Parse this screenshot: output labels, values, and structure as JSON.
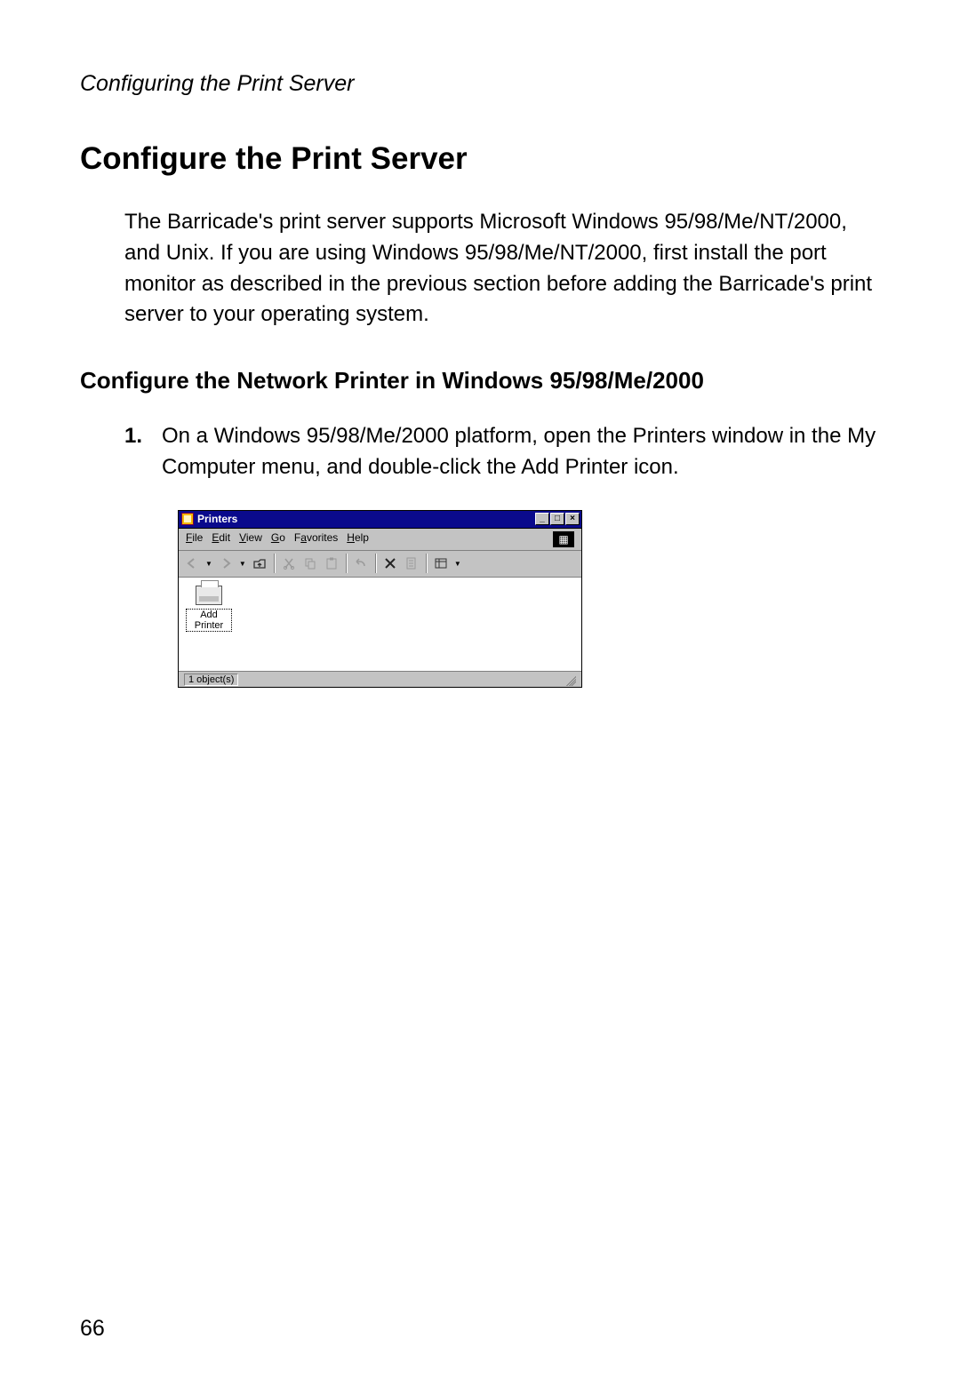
{
  "running_header": "Configuring the Print Server",
  "h1": "Configure the Print Server",
  "intro": "The Barricade's print server supports Microsoft Windows 95/98/Me/NT/2000, and Unix. If you are using Windows 95/98/Me/NT/2000, first install the port monitor as described in the previous section before adding the Barricade's print server to your operating system.",
  "h2": "Configure the Network Printer in Windows 95/98/Me/2000",
  "steps": [
    {
      "num": "1.",
      "text": "On a Windows 95/98/Me/2000 platform, open the Printers window in the My Computer menu, and double-click the Add Printer icon."
    }
  ],
  "page_number": "66",
  "win": {
    "title": "Printers",
    "menus": {
      "file": "File",
      "edit": "Edit",
      "view": "View",
      "go": "Go",
      "favorites": "Favorites",
      "help": "Help"
    },
    "icon_label": "Add Printer",
    "status": "1 object(s)",
    "ctrl": {
      "min": "_",
      "max": "□",
      "close": "×"
    }
  }
}
